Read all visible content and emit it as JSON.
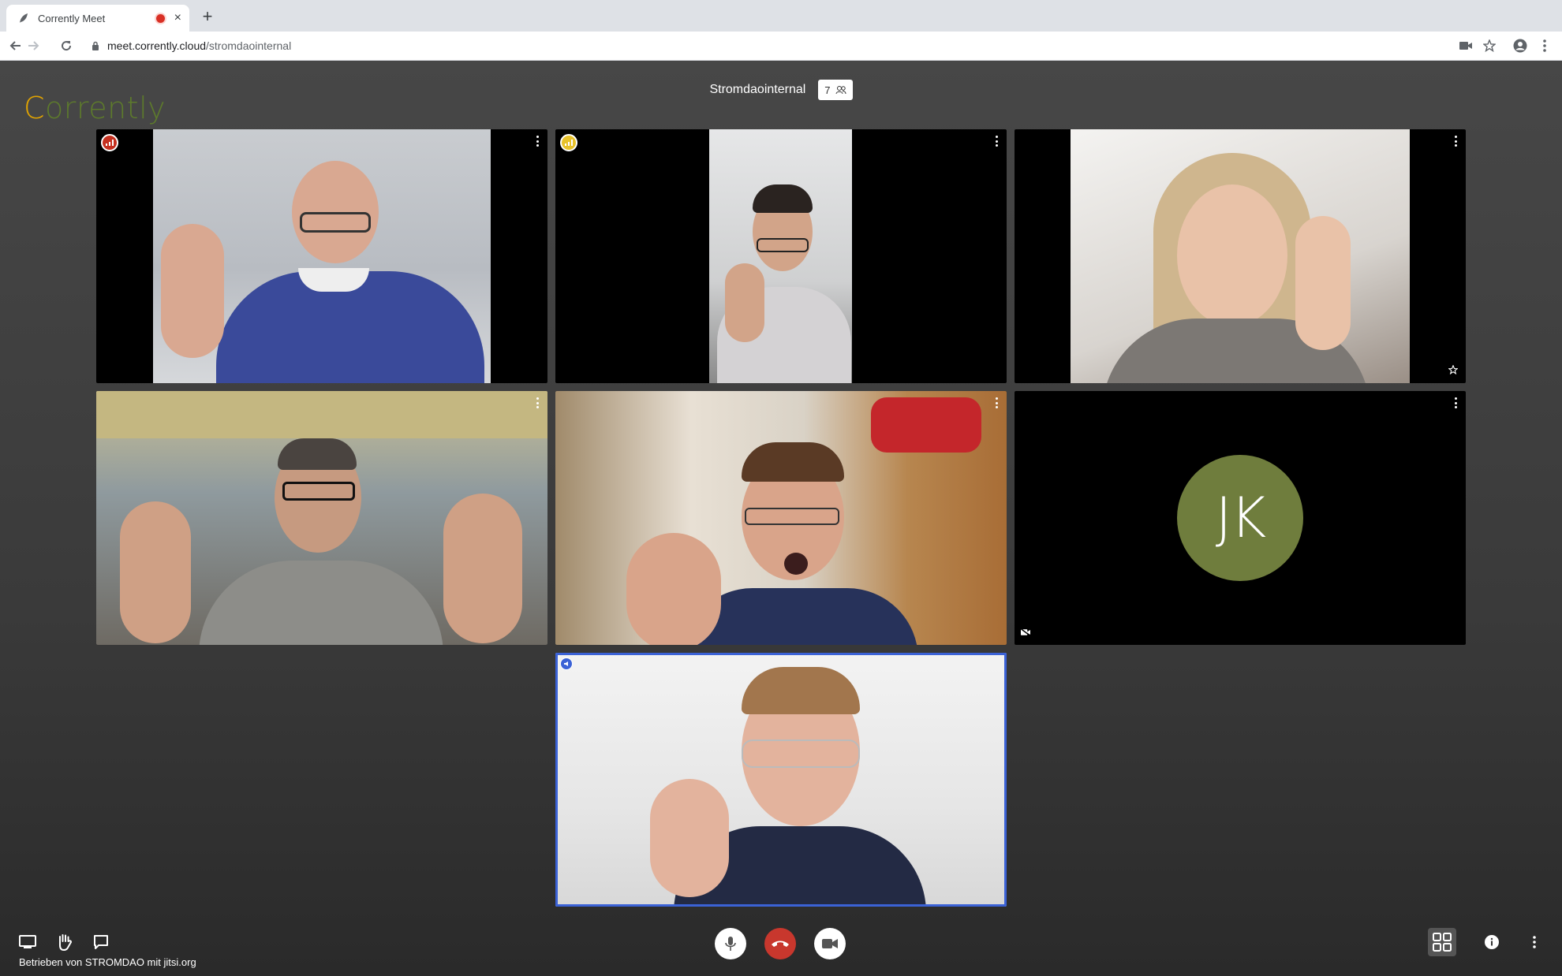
{
  "browser": {
    "tab_title": "Corrently Meet",
    "new_tab_symbol": "+",
    "close_symbol": "×",
    "url_host": "meet.corrently.cloud",
    "url_path": "/stromdaointernal"
  },
  "meeting": {
    "room_name": "Stromdaointernal",
    "participant_count": "7",
    "logo_first": "C",
    "logo_rest": "orrently",
    "avatar_initials": "JK",
    "credit": "Betrieben von STROMDAO mit jitsi.org"
  },
  "colors": {
    "accent": "#3b62d6",
    "hangup": "#c8372d",
    "avatar": "#6f7d3d",
    "logo_yellow": "#e2a400",
    "logo_green": "#5d7a2c"
  },
  "icons": [
    "back-icon",
    "forward-icon",
    "reload-icon",
    "lock-icon",
    "camera-icon",
    "star-icon",
    "account-icon",
    "kebab-icon",
    "screenshare-icon",
    "raise-hand-icon",
    "chat-icon",
    "microphone-icon",
    "hangup-icon",
    "video-icon",
    "tile-view-icon",
    "info-icon",
    "more-icon",
    "connection-indicator-icon",
    "dominant-speaker-icon",
    "video-muted-icon",
    "moderator-star-icon"
  ]
}
